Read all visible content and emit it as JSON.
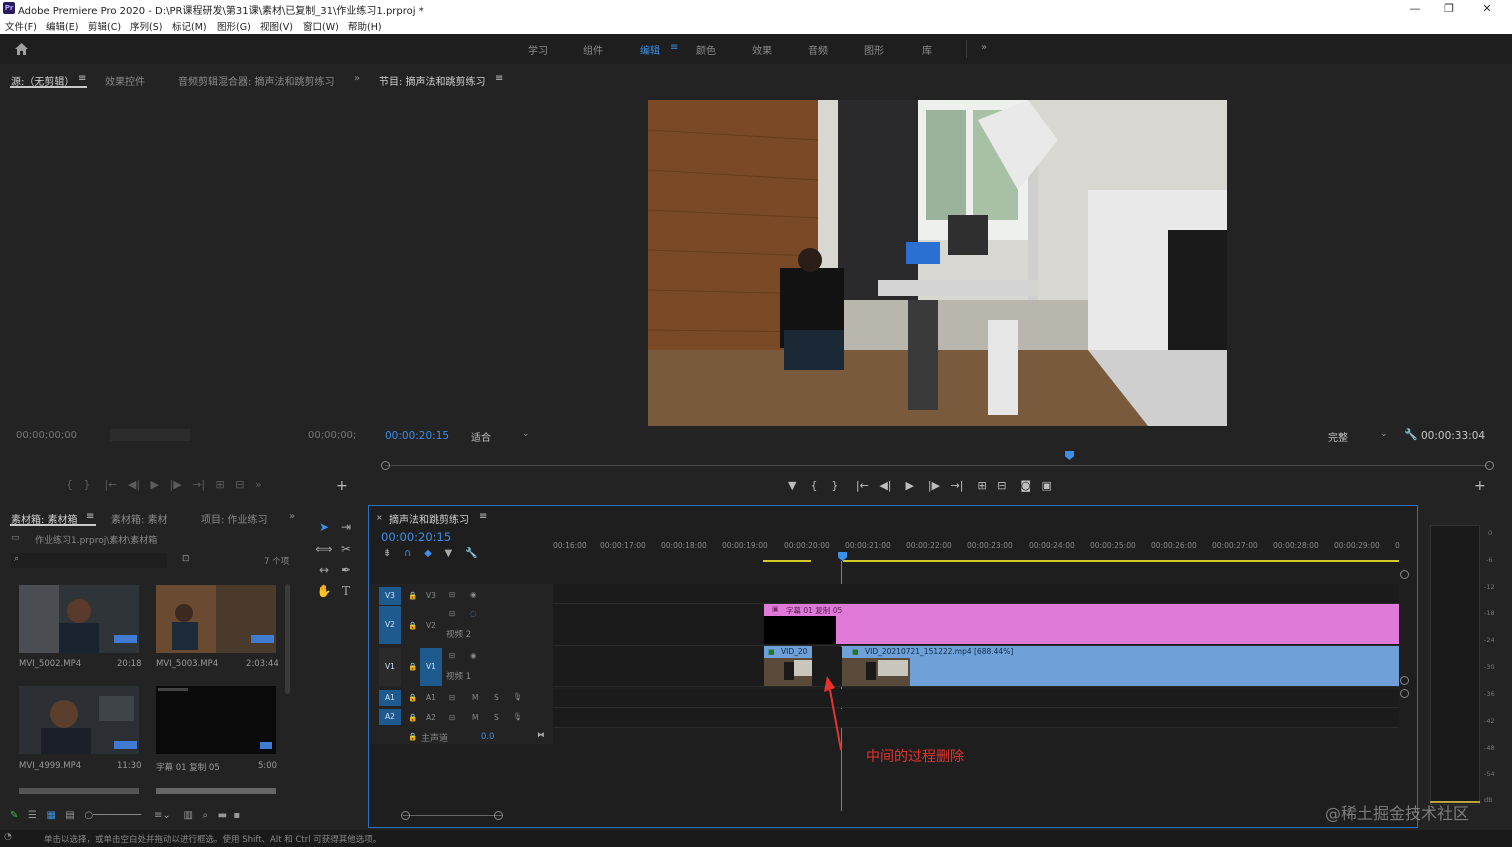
{
  "app": {
    "title": "Adobe Premiere Pro 2020 - D:\\PR课程研发\\第31课\\素材\\已复制_31\\作业练习1.prproj *",
    "logo": "Pr",
    "win_controls": [
      "—",
      "❐",
      "✕"
    ]
  },
  "menu": [
    "文件(F)",
    "编辑(E)",
    "剪辑(C)",
    "序列(S)",
    "标记(M)",
    "图形(G)",
    "视图(V)",
    "窗口(W)",
    "帮助(H)"
  ],
  "workspaces": {
    "items": [
      "学习",
      "组件",
      "编辑",
      "颜色",
      "效果",
      "音频",
      "图形",
      "库"
    ],
    "active": "编辑",
    "more": "»"
  },
  "source_panel": {
    "tabs": [
      "源:（无剪辑）",
      "效果控件",
      "音频剪辑混合器: 摘声法和跳剪练习"
    ],
    "active": "源:（无剪辑）",
    "timecode_left": "00;00;00;00",
    "timecode_right": "00;00;00;"
  },
  "program_panel": {
    "title": "节目: 摘声法和跳剪练习",
    "timecode": "00:00:20:15",
    "fit": "适合",
    "quality": "完整",
    "duration": "00:00:33:04"
  },
  "project_panel": {
    "tabs": [
      "素材箱: 素材箱",
      "素材箱: 素材",
      "项目: 作业练习"
    ],
    "active": "素材箱: 素材箱",
    "path": "作业练习1.prproj\\素材\\素材箱",
    "count": "7 个项",
    "items": [
      {
        "name": "MVI_5002.MP4",
        "duration": "20:18"
      },
      {
        "name": "MVI_5003.MP4",
        "duration": "2:03:44"
      },
      {
        "name": "MVI_4999.MP4",
        "duration": "11:30"
      },
      {
        "name": "字幕 01 复制 05",
        "duration": "5:00"
      }
    ]
  },
  "timeline": {
    "tab": "摘声法和跳剪练习",
    "timecode": "00:00:20:15",
    "ruler": [
      "00:16:00",
      "00:00:17:00",
      "00:00:18:00",
      "00:00:19:00",
      "00:00:20:00",
      "00:00:21:00",
      "00:00:22:00",
      "00:00:23:00",
      "00:00:24:00",
      "00:00:25:00",
      "00:00:26:00",
      "00:00:27:00",
      "00:00:28:00",
      "00:00:29:00",
      "0"
    ],
    "tracks": {
      "v3": "V3",
      "v2": "V2",
      "v2_name": "视频 2",
      "v1": "V1",
      "v1_name": "视频 1",
      "a1": "A1",
      "a2": "A2",
      "master": "主声道",
      "master_val": "0.0",
      "m": "M",
      "s": "S"
    },
    "clips": {
      "title_clip": "字幕 01 复制 05",
      "v1_left": "VID_20",
      "v1_right": "VID_20210721_151222.mp4 [688.44%]"
    },
    "annotation": "中间的过程删除"
  },
  "meter_ticks": [
    "0",
    "-6",
    "-12",
    "-18",
    "-24",
    "-30",
    "-36",
    "-42",
    "-48",
    "-54",
    "dB"
  ],
  "status": "单击以选择，或单击空白处并拖动以进行框选。使用 Shift、Alt 和 Ctrl 可获得其他选项。",
  "watermark": "@稀土掘金技术社区",
  "colors": {
    "accent": "#3b8fe8",
    "title_clip": "#e07ad8",
    "video_clip": "#6fa0d8",
    "annotation": "#e8322c"
  }
}
